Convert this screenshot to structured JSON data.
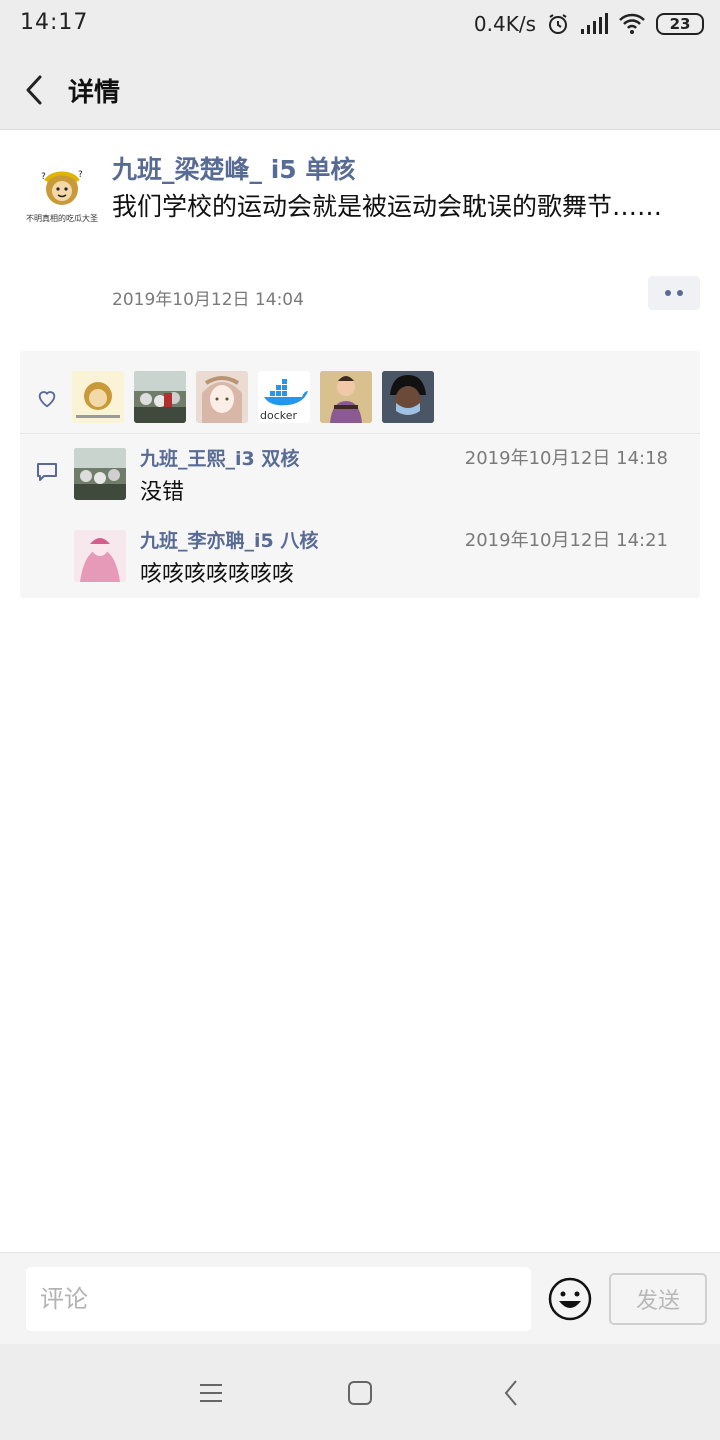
{
  "status_bar": {
    "time": "14:17",
    "network_speed": "0.4K/s",
    "battery": "23",
    "icons": [
      "alarm-icon",
      "signal-icon",
      "wifi-icon",
      "battery-icon"
    ]
  },
  "header": {
    "title": "详情",
    "back_icon": "chevron-left-icon"
  },
  "post": {
    "author": "九班_梁楚峰_ i5 单核",
    "avatar_caption": "不明真相的吃瓜大圣",
    "text": "我们学校的运动会就是被运动会耽误的歌舞节……",
    "time": "2019年10月12日 14:04",
    "more_icon": "more-dots-icon"
  },
  "likes": {
    "icon": "heart-icon",
    "avatars": [
      {
        "name": "avatar-sage",
        "color": "#f2e3a6"
      },
      {
        "name": "avatar-crowd",
        "color": "#6f7d6a"
      },
      {
        "name": "avatar-anime-girl",
        "color": "#e9d2c7"
      },
      {
        "name": "avatar-docker",
        "label": "docker",
        "color": "#ffffff"
      },
      {
        "name": "avatar-guitar",
        "color": "#8c5a92"
      },
      {
        "name": "avatar-mask",
        "color": "#2d3340"
      }
    ]
  },
  "comments": [
    {
      "name": "九班_王熙_i3 双核",
      "time": "2019年10月12日 14:18",
      "text": "没错"
    },
    {
      "name": "九班_李亦聃_i5 八核",
      "time": "2019年10月12日 14:21",
      "text": "咳咳咳咳咳咳咳"
    }
  ],
  "input_bar": {
    "placeholder": "评论",
    "send_label": "发送",
    "emoji_icon": "emoji-icon"
  },
  "nav_bar": {
    "icons": [
      "menu-icon",
      "home-square-icon",
      "back-arrow-icon"
    ]
  },
  "colors": {
    "link_blue": "#576b95",
    "bar_gray": "#ededed",
    "panel_gray": "#f6f6f6"
  }
}
